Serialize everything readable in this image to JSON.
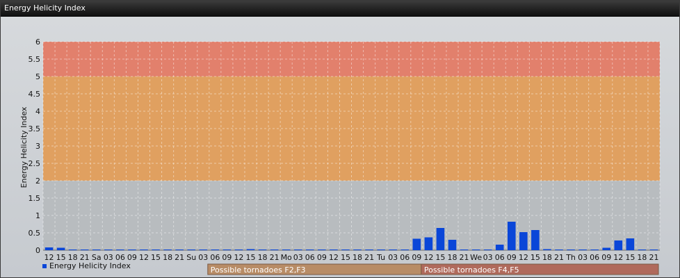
{
  "window": {
    "title": "Energy Helicity Index"
  },
  "colors": {
    "bar": "#0a46d8",
    "band_low": "#b8bcbf",
    "band_mid": "#e0a060",
    "band_high": "#e2806c",
    "ann1": "#b88c66",
    "ann2": "#b06a5c"
  },
  "chart_data": {
    "type": "bar",
    "ylabel": "Energy Helicity Index",
    "ylim": [
      0,
      6
    ],
    "yticks": [
      "0",
      "0.5",
      "1",
      "1.5",
      "2",
      "2.5",
      "3",
      "3.5",
      "4",
      "4.5",
      "5",
      "5.5",
      "6"
    ],
    "grid": true,
    "categories": [
      "12",
      "15",
      "18",
      "21",
      "Sa",
      "03",
      "06",
      "09",
      "12",
      "15",
      "18",
      "21",
      "Su",
      "03",
      "06",
      "09",
      "12",
      "15",
      "18",
      "21",
      "Mo",
      "03",
      "06",
      "09",
      "12",
      "15",
      "18",
      "21",
      "Tu",
      "03",
      "06",
      "09",
      "12",
      "15",
      "18",
      "21",
      "We",
      "03",
      "06",
      "09",
      "12",
      "15",
      "18",
      "21",
      "Th",
      "03",
      "06",
      "09",
      "12",
      "15",
      "18",
      "21"
    ],
    "series": [
      {
        "name": "Energy Helicity Index",
        "values": [
          0.08,
          0.07,
          0.02,
          0.02,
          0.02,
          0.02,
          0.02,
          0.02,
          0.02,
          0.02,
          0.02,
          0.02,
          0.02,
          0.02,
          0.02,
          0.02,
          0.02,
          0.03,
          0.02,
          0.02,
          0.02,
          0.02,
          0.02,
          0.02,
          0.02,
          0.02,
          0.02,
          0.02,
          0.02,
          0.02,
          0.02,
          0.33,
          0.37,
          0.64,
          0.3,
          0.02,
          0.02,
          0.02,
          0.16,
          0.82,
          0.52,
          0.58,
          0.03,
          0.02,
          0.02,
          0.02,
          0.02,
          0.07,
          0.28,
          0.34,
          0.02,
          0.02
        ]
      }
    ],
    "bands": [
      {
        "from": 0,
        "to": 2,
        "color": "#b8bcbf"
      },
      {
        "from": 2,
        "to": 5,
        "color": "#e0a060"
      },
      {
        "from": 5,
        "to": 6,
        "color": "#e2806c"
      }
    ],
    "annotations": [
      {
        "label": "Possible tornadoes F2,F3",
        "from_index": 14,
        "to_index": 31,
        "color": "#b88c66"
      },
      {
        "label": "Possible tornadoes F4,F5",
        "from_index": 32,
        "to_index": 51,
        "color": "#b06a5c"
      }
    ],
    "legend_position": "bottom-left"
  }
}
